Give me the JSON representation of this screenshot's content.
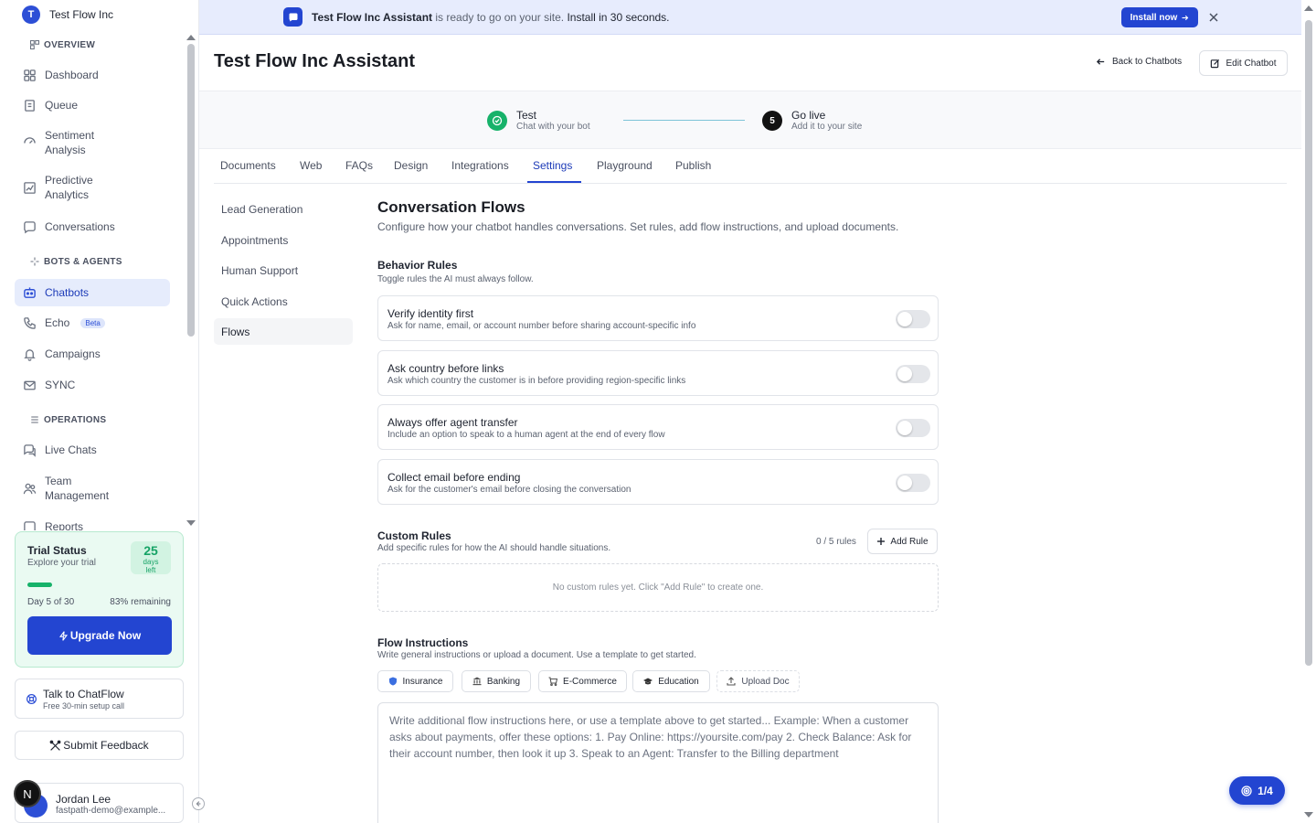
{
  "org": {
    "logo_letter": "T",
    "name": "Test Flow Inc"
  },
  "sidebar": {
    "sections": {
      "overview": "OVERVIEW",
      "bots": "BOTS & AGENTS",
      "operations": "OPERATIONS"
    },
    "items": {
      "dashboard": "Dashboard",
      "queue": "Queue",
      "sentiment_1": "Sentiment",
      "sentiment_2": "Analysis",
      "predictive_1": "Predictive",
      "predictive_2": "Analytics",
      "conversations": "Conversations",
      "chatbots": "Chatbots",
      "echo": "Echo",
      "echo_badge": "Beta",
      "campaigns": "Campaigns",
      "sync": "SYNC",
      "live_chats": "Live Chats",
      "team_1": "Team",
      "team_2": "Management",
      "reports": "Reports"
    }
  },
  "trial": {
    "title": "Trial Status",
    "subtitle": "Explore your trial",
    "days_number": "25",
    "days_label_1": "days",
    "days_label_2": "left",
    "day_progress": "Day 5 of 30",
    "remaining": "83% remaining",
    "progress_fraction": 0.17,
    "upgrade_label": "Upgrade Now"
  },
  "talk": {
    "title": "Talk to ChatFlow",
    "subtitle": "Free 30-min setup call"
  },
  "feedback_label": "Submit Feedback",
  "user": {
    "badge_letter": "N",
    "name": "Jordan Lee",
    "email": "fastpath-demo@example..."
  },
  "banner": {
    "bot_name": "Test Flow Inc Assistant",
    "middle": " is ready to go on your site. ",
    "cta_text": "Install in 30 seconds.",
    "install_label": "Install now"
  },
  "header": {
    "title": "Test Flow Inc Assistant",
    "back_label": "Back to Chatbots",
    "edit_label": "Edit Chatbot"
  },
  "stepper": {
    "step1_title": "Test",
    "step1_sub": "Chat with your bot",
    "step2_number": "5",
    "step2_title": "Go live",
    "step2_sub": "Add it to your site"
  },
  "tabs": [
    "Documents",
    "Web",
    "FAQs",
    "Design",
    "Integrations",
    "Settings",
    "Playground",
    "Publish"
  ],
  "active_tab": "Settings",
  "subnav": [
    "Lead Generation",
    "Appointments",
    "Human Support",
    "Quick Actions",
    "Flows"
  ],
  "active_subnav": "Flows",
  "content": {
    "title": "Conversation Flows",
    "subtitle": "Configure how your chatbot handles conversations. Set rules, add flow instructions, and upload documents.",
    "behavior_title": "Behavior Rules",
    "behavior_sub": "Toggle rules the AI must always follow.",
    "rules": [
      {
        "title": "Verify identity first",
        "desc": "Ask for name, email, or account number before sharing account-specific info",
        "enabled": false
      },
      {
        "title": "Ask country before links",
        "desc": "Ask which country the customer is in before providing region-specific links",
        "enabled": false
      },
      {
        "title": "Always offer agent transfer",
        "desc": "Include an option to speak to a human agent at the end of every flow",
        "enabled": false
      },
      {
        "title": "Collect email before ending",
        "desc": "Ask for the customer's email before closing the conversation",
        "enabled": false
      }
    ],
    "custom_title": "Custom Rules",
    "custom_sub": "Add specific rules for how the AI should handle situations.",
    "rules_count": "0 / 5 rules",
    "add_rule_label": "Add Rule",
    "empty_rules": "No custom rules yet. Click \"Add Rule\" to create one.",
    "flow_title": "Flow Instructions",
    "flow_sub": "Write general instructions or upload a document. Use a template to get started.",
    "templates": [
      "Insurance",
      "Banking",
      "E-Commerce",
      "Education"
    ],
    "upload_label": "Upload Doc",
    "textarea_placeholder": "Write additional flow instructions here, or use a template above to get started...     Example:   When a customer asks about payments, offer these options:   1. Pay Online: https://yoursite.com/pay   2. Check Balance: Ask for their account number, then look it up   3. Speak to an Agent: Transfer to the Billing department"
  },
  "fab_label": "1/4",
  "colors": {
    "brand": "#2345d1",
    "success": "#17b26a",
    "active_bg": "#e6ecfc"
  }
}
